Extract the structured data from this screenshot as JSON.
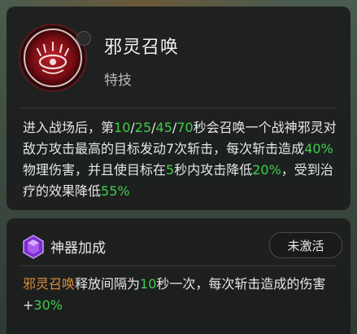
{
  "skill": {
    "name": "邪灵召唤",
    "type": "特技",
    "description": [
      {
        "t": "进入战场后，第",
        "c": "text"
      },
      {
        "t": "10",
        "c": "num"
      },
      {
        "t": "/",
        "c": "text"
      },
      {
        "t": "25",
        "c": "num"
      },
      {
        "t": "/",
        "c": "text"
      },
      {
        "t": "45",
        "c": "num"
      },
      {
        "t": "/",
        "c": "text"
      },
      {
        "t": "70",
        "c": "num"
      },
      {
        "t": "秒会召唤一个战神邪灵对敌方攻击最高的目标发动7次斩击，每次斩击造成",
        "c": "text"
      },
      {
        "t": "40%",
        "c": "num"
      },
      {
        "t": "物理伤害，并且使目标在",
        "c": "text"
      },
      {
        "t": "5",
        "c": "num"
      },
      {
        "t": "秒内攻击降低",
        "c": "text"
      },
      {
        "t": "20%",
        "c": "num"
      },
      {
        "t": "，受到治疗的效果降低",
        "c": "text"
      },
      {
        "t": "55%",
        "c": "num"
      }
    ]
  },
  "artifact": {
    "title": "神器加成",
    "status": "未激活",
    "bonus": [
      {
        "t": "邪灵召唤",
        "c": "hl"
      },
      {
        "t": "释放间隔为",
        "c": "text"
      },
      {
        "t": "10",
        "c": "num"
      },
      {
        "t": "秒一次，每次斩击造成的伤害+",
        "c": "text"
      },
      {
        "t": "30%",
        "c": "num"
      }
    ]
  },
  "colors": {
    "number": "#3fce4a",
    "highlight": "#d98b3a",
    "text": "#e6e6e6"
  },
  "icons": {
    "skill": "demon-eye-sigil-icon",
    "artifact": "purple-gem-icon"
  }
}
